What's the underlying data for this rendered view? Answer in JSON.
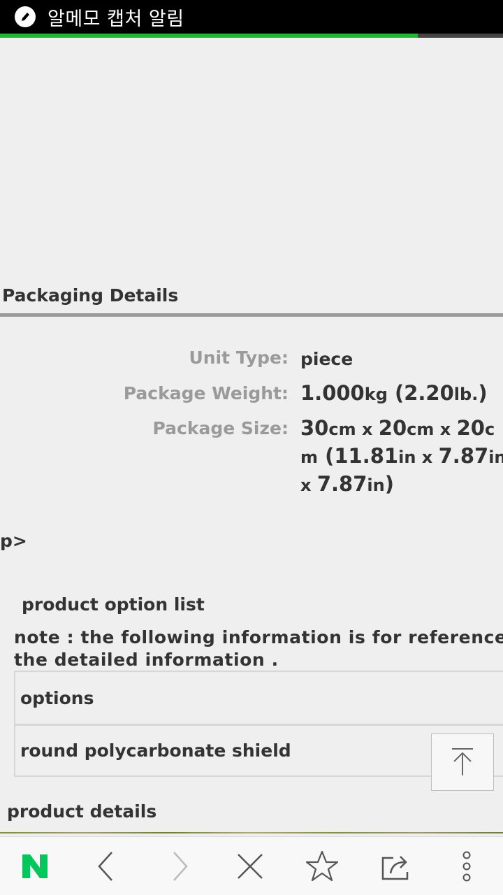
{
  "status_bar": {
    "title": "알메모 캡처 알림"
  },
  "page_load_progress": 0.83,
  "packaging": {
    "title": "Packaging Details",
    "unit_type": {
      "label": "Unit Type:",
      "value": "piece"
    },
    "package_weight": {
      "label": "Package Weight:",
      "value_num": "1.000",
      "value_unit": "kg",
      "value_alt": " (2.20",
      "value_alt_unit": "lb.",
      "value_alt_end": ")"
    },
    "package_size": {
      "label": "Package Size:",
      "line1": [
        "30",
        "cm",
        " x ",
        "20",
        "cm",
        " x ",
        "20",
        "c"
      ],
      "line2": [
        "m",
        " (",
        "11.81",
        "in",
        " x ",
        "7.87",
        "in"
      ],
      "line3": [
        "x ",
        "7.87",
        "in",
        ")"
      ]
    }
  },
  "stray_text": "p>",
  "options": {
    "title": "product option list",
    "note_line1": "note : the following information is for reference only",
    "note_line2": "the detailed information .",
    "rows": [
      "options",
      "round polycarbonate shield"
    ]
  },
  "details_title": "product details",
  "colors": {
    "progress": "#1bb934",
    "naver_green": "#03c75a",
    "label_gray": "#9a9a9a"
  },
  "bottom_nav": {
    "icons": [
      "naver-logo-icon",
      "back-icon",
      "forward-icon",
      "close-icon",
      "bookmark-star-icon",
      "share-icon",
      "more-icon"
    ]
  }
}
